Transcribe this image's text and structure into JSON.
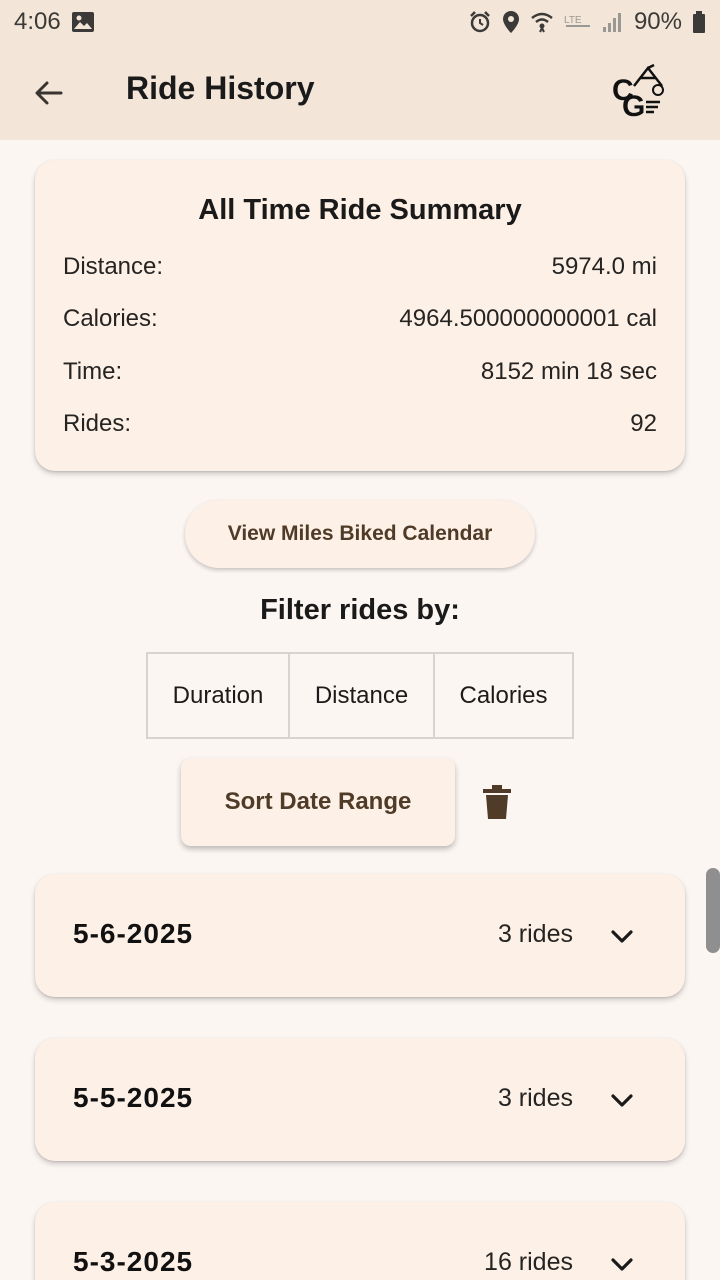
{
  "status_bar": {
    "time": "4:06",
    "battery": "90%",
    "icons": [
      "gallery-icon",
      "alarm-icon",
      "location-icon",
      "wifi-icon",
      "lte-icon",
      "signal-icon",
      "battery-icon"
    ]
  },
  "app_bar": {
    "title": "Ride History",
    "back_icon": "back-arrow-icon",
    "logo_text": "CG"
  },
  "summary": {
    "title": "All Time Ride Summary",
    "rows": [
      {
        "label": "Distance:",
        "value": "5974.0 mi"
      },
      {
        "label": "Calories:",
        "value": "4964.500000000001 cal"
      },
      {
        "label": "Time:",
        "value": "8152 min 18 sec"
      },
      {
        "label": "Rides:",
        "value": "92"
      }
    ]
  },
  "calendar_button": "View Miles Biked Calendar",
  "filter": {
    "label": "Filter rides by:",
    "options": [
      "Duration",
      "Distance",
      "Calories"
    ]
  },
  "sort_button": "Sort Date Range",
  "rides": [
    {
      "date": "5-6-2025",
      "count": "3 rides"
    },
    {
      "date": "5-5-2025",
      "count": "3 rides"
    },
    {
      "date": "5-3-2025",
      "count": "16 rides"
    }
  ],
  "colors": {
    "bar_background": "#f3e6d8",
    "page_background": "#fcf6f3",
    "card_background": "#fdf0e6",
    "button_text": "#4f3b27"
  }
}
